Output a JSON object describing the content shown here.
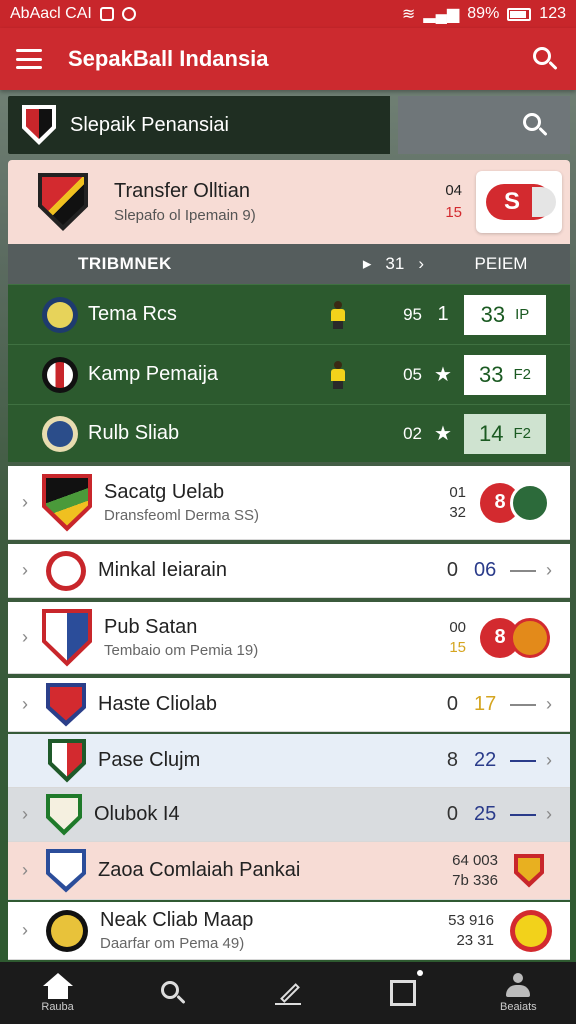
{
  "status_bar": {
    "left_text": "AbAacl CAI",
    "battery": "89%",
    "time": "123"
  },
  "app_bar": {
    "title": "SepakBall Indansia"
  },
  "search": {
    "league_name": "Slepaik Penansiai"
  },
  "transfer": {
    "title": "Transfer Olltian",
    "subtitle": "Slepafo ol Ipemain 9)",
    "num_top": "04",
    "num_bottom": "15",
    "badge": "S"
  },
  "table_header": {
    "label": "TRIBMNEK",
    "mid": "31",
    "right": "PEIEM"
  },
  "standings": [
    {
      "name": "Tema Rcs",
      "num": "95",
      "mark": "1",
      "score": "33",
      "suffix": "IP"
    },
    {
      "name": "Kamp Pemaija",
      "num": "05",
      "mark": "★",
      "score": "33",
      "suffix": "F2"
    },
    {
      "name": "Rulb Sliab",
      "num": "02",
      "mark": "★",
      "score": "14",
      "suffix": "F2"
    }
  ],
  "clubs": [
    {
      "name": "Sacatg Uelab",
      "sub": "Dransfeoml Derma SS)",
      "n1": "01",
      "n2": "32",
      "badge": "8"
    },
    {
      "name": "Minkal Ieiarain",
      "a": "0",
      "b": "06"
    },
    {
      "name": "Pub Satan",
      "sub": "Tembaio om Pemia 19)",
      "n1": "00",
      "n2": "15",
      "badge": "8"
    },
    {
      "name": "Haste Cliolab",
      "a": "0",
      "b": "17"
    },
    {
      "name": "Pase Clujm",
      "a": "8",
      "b": "22"
    },
    {
      "name": "Olubok I4",
      "a": "0",
      "b": "25"
    },
    {
      "name": "Zaoa Comlaiah Pankai",
      "n1": "64  003",
      "n2": "7b 336"
    },
    {
      "name": "Neak Cliab Maap",
      "sub": "Daarfar om Pema 49)",
      "n1": "53  916",
      "n2": "23  31"
    }
  ],
  "bottom_nav": {
    "home": "Rauba",
    "profile": "Beaiats"
  },
  "colors": {
    "primary_red": "#cc2a2f",
    "dark_green": "#2c5a2e",
    "transfer_bg": "#f7dcd5"
  }
}
